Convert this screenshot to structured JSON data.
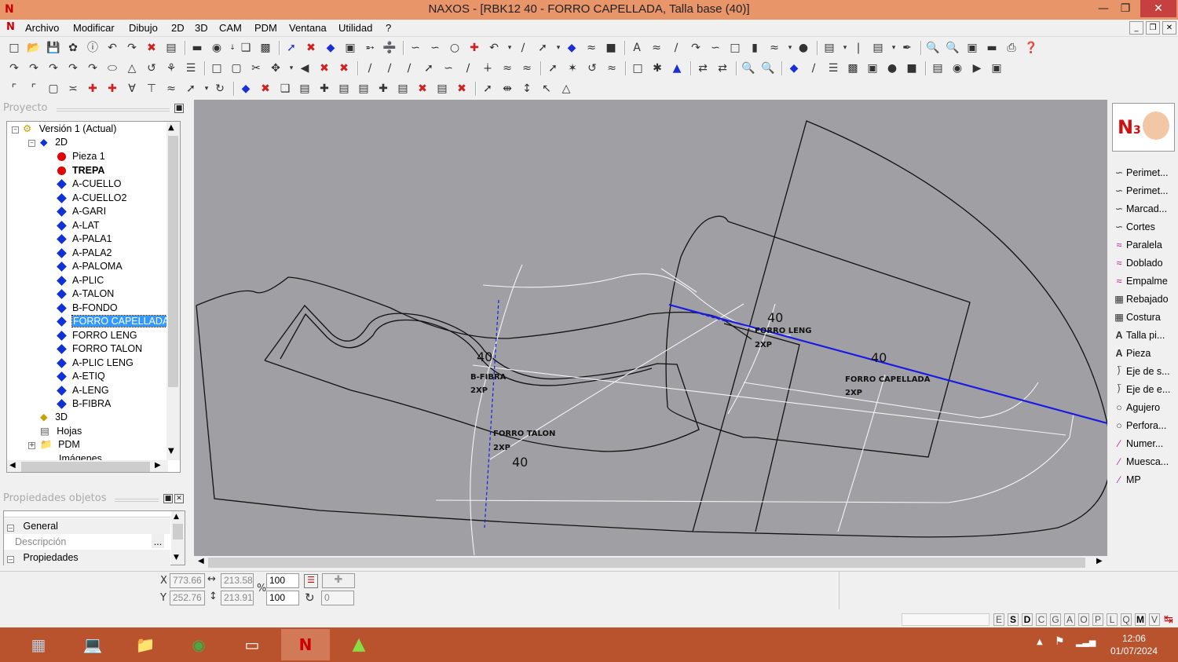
{
  "titlebar": {
    "title": "NAXOS - [RBK12 40 - FORRO CAPELLADA, Talla base (40)]",
    "app_icon": "N"
  },
  "menu": [
    "Archivo",
    "Modificar",
    "Dibujo",
    "2D",
    "3D",
    "CAM",
    "PDM",
    "Ventana",
    "Utilidad",
    "?"
  ],
  "project_panel": {
    "title": "Proyecto",
    "version": "Versión 1 (Actual)",
    "node_2d": "2D",
    "pieces": [
      {
        "label": "Pieza 1",
        "kind": "red"
      },
      {
        "label": "TREPA",
        "kind": "red",
        "bold": true
      },
      {
        "label": "A-CUELLO",
        "kind": "blue"
      },
      {
        "label": "A-CUELLO2",
        "kind": "blue"
      },
      {
        "label": "A-GARI",
        "kind": "blue"
      },
      {
        "label": "A-LAT",
        "kind": "blue"
      },
      {
        "label": "A-PALA1",
        "kind": "blue"
      },
      {
        "label": "A-PALA2",
        "kind": "blue"
      },
      {
        "label": "A-PALOMA",
        "kind": "blue"
      },
      {
        "label": "A-PLIC",
        "kind": "blue"
      },
      {
        "label": "A-TALON",
        "kind": "blue"
      },
      {
        "label": "B-FONDO",
        "kind": "blue"
      },
      {
        "label": "FORRO CAPELLADA",
        "kind": "blue",
        "selected": true
      },
      {
        "label": "FORRO LENG",
        "kind": "blue"
      },
      {
        "label": "FORRO TALON",
        "kind": "blue"
      },
      {
        "label": "A-PLIC LENG",
        "kind": "blue"
      },
      {
        "label": "A-ETIQ",
        "kind": "blue"
      },
      {
        "label": "A-LENG",
        "kind": "blue"
      },
      {
        "label": "B-FIBRA",
        "kind": "blue"
      }
    ],
    "node_3d": "3D",
    "node_hojas": "Hojas",
    "node_pdm": "PDM",
    "node_imagenes": "Imágenes"
  },
  "props_panel": {
    "title": "Propiedades objetos",
    "general": "General",
    "descripcion": "Descripción",
    "descripcion_btn": "...",
    "propiedades": "Propiedades"
  },
  "canvas": {
    "labels": {
      "fibra_size": "40",
      "fibra_name": "B-FIBRA",
      "fibra_qty": "2XP",
      "talon_name": "FORRO TALON",
      "talon_qty": "2XP",
      "talon_size": "40",
      "leng_size": "40",
      "leng_name": "FORRO LENG",
      "leng_qty": "2XP",
      "cap_size": "40",
      "cap_name": "FORRO CAPELLADA",
      "cap_qty": "2XP"
    }
  },
  "tools": [
    "Perimet...",
    "Perimet...",
    "Marcad...",
    "Cortes",
    "Paralela",
    "Doblado",
    "Empalme",
    "Rebajado",
    "Costura",
    "Talla pi...",
    "Pieza",
    "Eje de s...",
    "Eje de e...",
    "Agujero",
    "Perfora...",
    "Numer...",
    "Muesca...",
    "MP"
  ],
  "status": {
    "x_label": "X",
    "y_label": "Y",
    "x": "773.66",
    "y": "252.76",
    "w": "213.58",
    "h": "213.91",
    "pct_label": "%",
    "scale_x": "100",
    "scale_y": "100",
    "rotation": "0"
  },
  "mode_letters": [
    "E",
    "S",
    "D",
    "C",
    "G",
    "A",
    "O",
    "P",
    "L",
    "Q",
    "M",
    "V"
  ],
  "clock": {
    "time": "12:06",
    "date": "01/07/2024"
  },
  "colors": {
    "titlebar": "#e8956a",
    "canvas": "#a0a0a4",
    "taskbar": "#b8532e",
    "selection_line": "#1a1ae6",
    "selected_row": "#3399ff"
  }
}
